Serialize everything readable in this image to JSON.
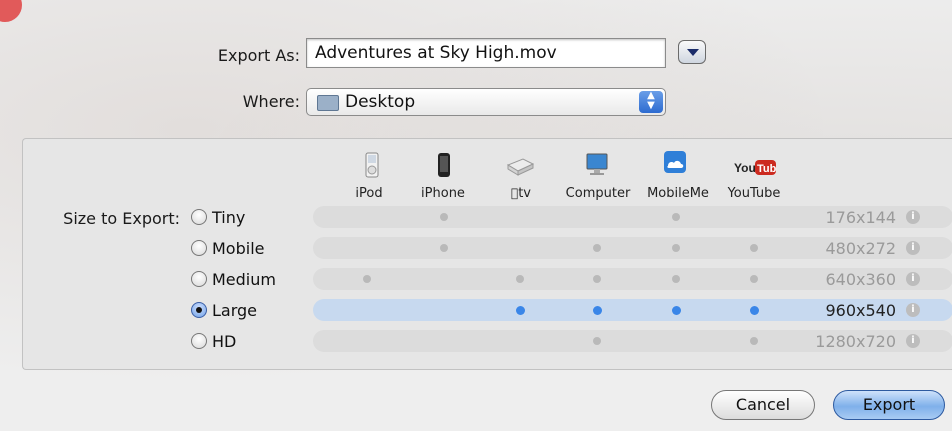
{
  "export_as": {
    "label": "Export As:",
    "value": "Adventures at Sky High.mov"
  },
  "where": {
    "label": "Where:",
    "value": "Desktop"
  },
  "devices": [
    "iPod",
    "iPhone",
    "tv",
    "Computer",
    "MobileMe",
    "YouTube"
  ],
  "size_label": "Size to Export:",
  "sizes": [
    {
      "name": "Tiny",
      "res": "176x144",
      "selected": false,
      "devices": [
        false,
        true,
        false,
        false,
        true,
        false
      ]
    },
    {
      "name": "Mobile",
      "res": "480x272",
      "selected": false,
      "devices": [
        false,
        true,
        false,
        true,
        true,
        true
      ]
    },
    {
      "name": "Medium",
      "res": "640x360",
      "selected": false,
      "devices": [
        true,
        false,
        true,
        true,
        true,
        true
      ]
    },
    {
      "name": "Large",
      "res": "960x540",
      "selected": true,
      "devices": [
        false,
        false,
        true,
        true,
        true,
        true
      ]
    },
    {
      "name": "HD",
      "res": "1280x720",
      "selected": false,
      "devices": [
        false,
        false,
        false,
        true,
        false,
        true
      ]
    }
  ],
  "buttons": {
    "cancel": "Cancel",
    "export": "Export"
  },
  "colors": {
    "accent": "#3a86e8",
    "selected_row": "#c7d9ef"
  }
}
